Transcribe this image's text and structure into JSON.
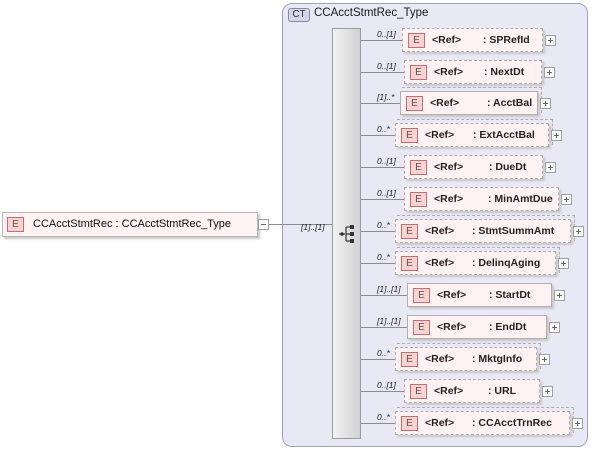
{
  "complex_type": {
    "badge": "CT",
    "title": "CCAcctStmtRec_Type"
  },
  "root": {
    "badge": "E",
    "label": "CCAcctStmtRec : CCAcctStmtRec_Type",
    "multiplicity": "[1]..[1]"
  },
  "children": [
    {
      "multiplicity": "0..[1]",
      "badge": "E",
      "ref": "<Ref>",
      "name": ": SPRefId",
      "occurrence": "optional"
    },
    {
      "multiplicity": "0..[1]",
      "badge": "E",
      "ref": "<Ref>",
      "name": ": NextDt",
      "occurrence": "optional"
    },
    {
      "multiplicity": "[1]..*",
      "badge": "E",
      "ref": "<Ref>",
      "name": ": AcctBal",
      "occurrence": "required-unbounded"
    },
    {
      "multiplicity": "0..*",
      "badge": "E",
      "ref": "<Ref>",
      "name": ": ExtAcctBal",
      "occurrence": "optional-unbounded"
    },
    {
      "multiplicity": "0..[1]",
      "badge": "E",
      "ref": "<Ref>",
      "name": ": DueDt",
      "occurrence": "optional"
    },
    {
      "multiplicity": "0..[1]",
      "badge": "E",
      "ref": "<Ref>",
      "name": ": MinAmtDue",
      "occurrence": "optional"
    },
    {
      "multiplicity": "0..*",
      "badge": "E",
      "ref": "<Ref>",
      "name": ": StmtSummAmt",
      "occurrence": "optional-unbounded"
    },
    {
      "multiplicity": "0..*",
      "badge": "E",
      "ref": "<Ref>",
      "name": ": DelinqAging",
      "occurrence": "optional-unbounded"
    },
    {
      "multiplicity": "[1]..[1]",
      "badge": "E",
      "ref": "<Ref>",
      "name": ": StartDt",
      "occurrence": "required"
    },
    {
      "multiplicity": "[1]..[1]",
      "badge": "E",
      "ref": "<Ref>",
      "name": ": EndDt",
      "occurrence": "required"
    },
    {
      "multiplicity": "0..*",
      "badge": "E",
      "ref": "<Ref>",
      "name": ": MktgInfo",
      "occurrence": "optional-unbounded"
    },
    {
      "multiplicity": "0..[1]",
      "badge": "E",
      "ref": "<Ref>",
      "name": ": URL",
      "occurrence": "optional"
    },
    {
      "multiplicity": "0..*",
      "badge": "E",
      "ref": "<Ref>",
      "name": ": CCAcctTrnRec",
      "occurrence": "optional-unbounded"
    }
  ]
}
